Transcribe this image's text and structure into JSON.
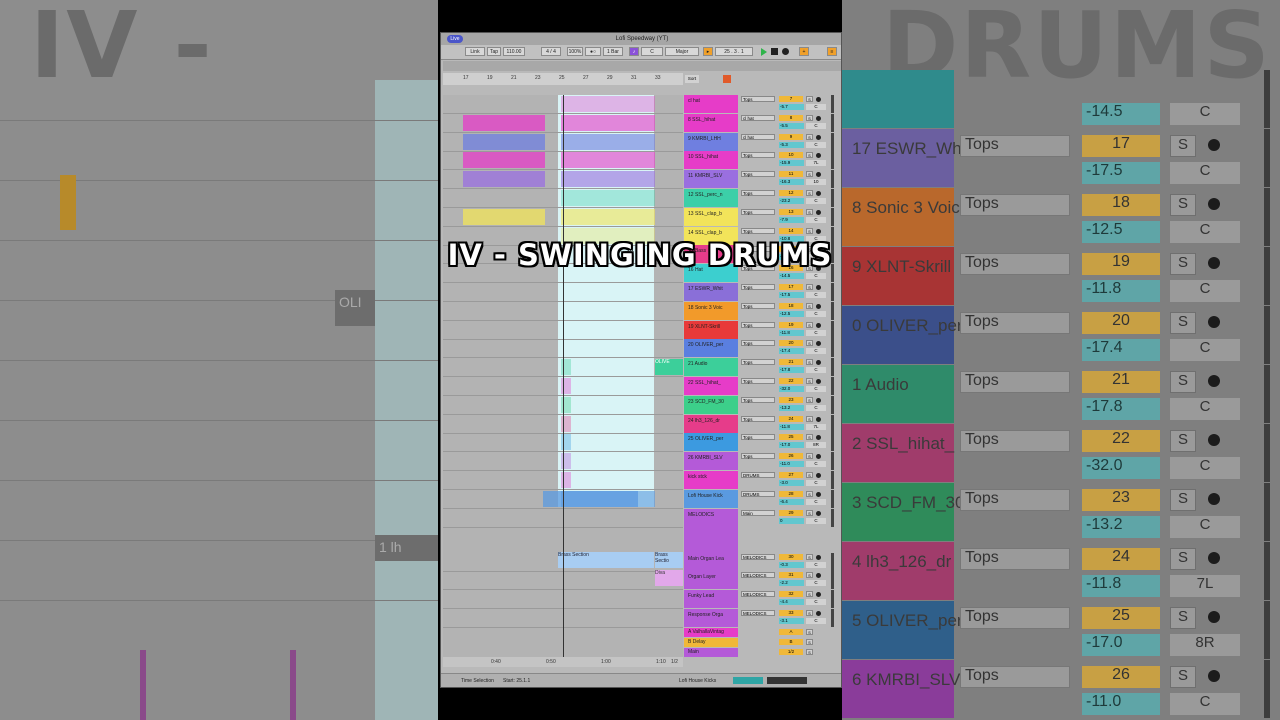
{
  "window": {
    "title": "Lofi Speedway (YT)",
    "menu_label": "Live"
  },
  "transport": {
    "link": "Link",
    "tap": "Tap",
    "tempo": "110.00",
    "signature": "4 / 4",
    "zoom": "100%",
    "quantize": "1 Bar",
    "key": "C",
    "scale": "Major",
    "position": "25 .  3 .  1"
  },
  "ruler": {
    "bars": [
      "17",
      "19",
      "21",
      "23",
      "25",
      "27",
      "29",
      "31",
      "33"
    ]
  },
  "timeline": {
    "times": [
      "0:40",
      "0:50",
      "1:00",
      "1:10"
    ],
    "page": "1/2"
  },
  "background": {
    "left_text": "IV -",
    "right_text": "DRUMS",
    "left_clip": "OLI",
    "left_clip2": "1  lh"
  },
  "bg_rows": [
    {
      "name": "",
      "io": "",
      "num": "",
      "vol": "-14.5",
      "c": "C",
      "color": "#2f8b8c"
    },
    {
      "name": "17 ESWR_Whit",
      "io": "Tops",
      "num": "17",
      "vol": "-17.5",
      "c": "C",
      "color": "#6b5fa0"
    },
    {
      "name": "8 Sonic 3 Voic",
      "io": "Tops",
      "num": "18",
      "vol": "-12.5",
      "c": "C",
      "color": "#b9682c"
    },
    {
      "name": "9 XLNT-Skrill",
      "io": "Tops",
      "num": "19",
      "vol": "-11.8",
      "c": "C",
      "color": "#a83434"
    },
    {
      "name": "0 OLIVER_per",
      "io": "Tops",
      "num": "20",
      "vol": "-17.4",
      "c": "C",
      "color": "#3b4f8a"
    },
    {
      "name": "1 Audio",
      "io": "Tops",
      "num": "21",
      "vol": "-17.8",
      "c": "C",
      "color": "#2f8b6a"
    },
    {
      "name": "2 SSL_hihat_",
      "io": "Tops",
      "num": "22",
      "vol": "-32.0",
      "c": "C",
      "color": "#a03c6b"
    },
    {
      "name": "3 SCD_FM_30",
      "io": "Tops",
      "num": "23",
      "vol": "-13.2",
      "c": "C",
      "color": "#2f8b5a"
    },
    {
      "name": "4 lh3_126_dr",
      "io": "Tops",
      "num": "24",
      "vol": "-11.8",
      "c": "7L",
      "color": "#a03c6b"
    },
    {
      "name": "5 OLIVER_per",
      "io": "Tops",
      "num": "25",
      "vol": "-17.0",
      "c": "8R",
      "color": "#2f5f8a"
    },
    {
      "name": "6 KMRBI_SLV",
      "io": "Tops",
      "num": "26",
      "vol": "-11.0",
      "c": "C",
      "color": "#8a3c9a"
    }
  ],
  "tracks": [
    {
      "name": "cl hat",
      "io": "Tops",
      "num": "7",
      "vol": "-5.7",
      "pan": "C",
      "color": "#e63cc8"
    },
    {
      "name": "8 SSL_hihat",
      "io": "cl hat",
      "num": "8",
      "vol": "-5.5",
      "pan": "C",
      "color": "#e63cc8"
    },
    {
      "name": "9 KMRBI_LHH",
      "io": "cl hat",
      "num": "9",
      "vol": "-5.3",
      "pan": "C",
      "color": "#6f7fe0"
    },
    {
      "name": "10 SSL_hihat",
      "io": "Tops",
      "num": "10",
      "vol": "-15.9",
      "pan": "7L",
      "color": "#e63cc8"
    },
    {
      "name": "11 KMRBI_SLV",
      "io": "Tops",
      "num": "11",
      "vol": "-16.3",
      "pan": "10",
      "color": "#9a6fe0"
    },
    {
      "name": "12 SSL_perc_n",
      "io": "Tops",
      "num": "12",
      "vol": "-23.2",
      "pan": "C",
      "color": "#3ccfa8"
    },
    {
      "name": "13 SSL_clap_b",
      "io": "Tops",
      "num": "13",
      "vol": "-7.9",
      "pan": "C",
      "color": "#f2e45a"
    },
    {
      "name": "14 SSL_clap_b",
      "io": "Tops",
      "num": "14",
      "vol": "-10.8",
      "pan": "C",
      "color": "#f2e45a"
    },
    {
      "name": "15 Bass",
      "io": "Tops",
      "num": "15",
      "vol": "-14.5",
      "pan": "C",
      "color": "#e63c8a"
    },
    {
      "name": "16 Hat",
      "io": "Tops",
      "num": "16",
      "vol": "-14.5",
      "pan": "C",
      "color": "#3ccfcf"
    },
    {
      "name": "17 ESWR_Whit",
      "io": "Tops",
      "num": "17",
      "vol": "-17.5",
      "pan": "C",
      "color": "#8a6fd8"
    },
    {
      "name": "18 Sonic 3 Voic",
      "io": "Tops",
      "num": "18",
      "vol": "-12.5",
      "pan": "C",
      "color": "#f29a2a"
    },
    {
      "name": "19 XLNT-Skrill",
      "io": "Tops",
      "num": "19",
      "vol": "-11.8",
      "pan": "C",
      "color": "#e83a3a"
    },
    {
      "name": "20 OLIVER_per",
      "io": "Tops",
      "num": "20",
      "vol": "-17.4",
      "pan": "C",
      "color": "#5a7fe0"
    },
    {
      "name": "21 Audio",
      "io": "Tops",
      "num": "21",
      "vol": "-17.8",
      "pan": "C",
      "color": "#3ccf9a"
    },
    {
      "name": "22 SSL_hihat_",
      "io": "Tops",
      "num": "22",
      "vol": "-32.0",
      "pan": "C",
      "color": "#e63cc8"
    },
    {
      "name": "23 SCD_FM_30",
      "io": "Tops",
      "num": "23",
      "vol": "-13.2",
      "pan": "C",
      "color": "#3ccf8a"
    },
    {
      "name": "24 lh3_126_dr",
      "io": "Tops",
      "num": "24",
      "vol": "-11.8",
      "pan": "7L",
      "color": "#e63c8a"
    },
    {
      "name": "25 OLIVER_per",
      "io": "Tops",
      "num": "25",
      "vol": "-17.0",
      "pan": "8R",
      "color": "#3c9ae0"
    },
    {
      "name": "26 KMRBI_SLV",
      "io": "Tops",
      "num": "26",
      "vol": "-11.0",
      "pan": "C",
      "color": "#b45ad8"
    },
    {
      "name": "kick stck",
      "io": "DRUMS",
      "num": "27",
      "vol": "-3.0",
      "pan": "C",
      "color": "#e63cc8"
    },
    {
      "name": "Lofi House Kick",
      "io": "DRUMS",
      "num": "28",
      "vol": "-6.4",
      "pan": "C",
      "color": "#5a9ae0"
    },
    {
      "name": "MELODICS",
      "io": "Main",
      "num": "29",
      "vol": "0",
      "pan": "C",
      "color": "#b45ad8"
    },
    {
      "name": "Main Organ Lea",
      "io": "MELODICS",
      "num": "30",
      "vol": "-0.3",
      "pan": "C",
      "color": "#b45ad8"
    },
    {
      "name": "Organ Layer",
      "io": "MELODICS",
      "num": "31",
      "vol": "-2.2",
      "pan": "C",
      "color": "#b45ad8"
    },
    {
      "name": "Funky Lead",
      "io": "MELODICS",
      "num": "32",
      "vol": "-4.4",
      "pan": "C",
      "color": "#b45ad8"
    },
    {
      "name": "Response Orga",
      "io": "MELODICS",
      "num": "33",
      "vol": "-3.1",
      "pan": "C",
      "color": "#b45ad8"
    }
  ],
  "returns": [
    {
      "name": "A ValhallaVintag",
      "num": "A",
      "color": "#e63cc8"
    },
    {
      "name": "B Delay",
      "num": "B",
      "color": "#f0b838"
    },
    {
      "name": "Main",
      "num": "1/2",
      "color": "#b45ad8"
    }
  ],
  "clips": {
    "brass": "Brass Section",
    "brass2": "Brass Sectio",
    "diva": "Diva",
    "oli": "OLI",
    "oliver": "OLIVE"
  },
  "status": {
    "mode": "Time Selection",
    "start": "Start: 25.1.1",
    "track": "Lofi House Kicks"
  },
  "banner": {
    "text": "IV - SWINGING DRUMS"
  },
  "colors": {
    "accent": "#f0b838",
    "cyan": "#62c7cf",
    "loop": "#d9f4f6"
  }
}
